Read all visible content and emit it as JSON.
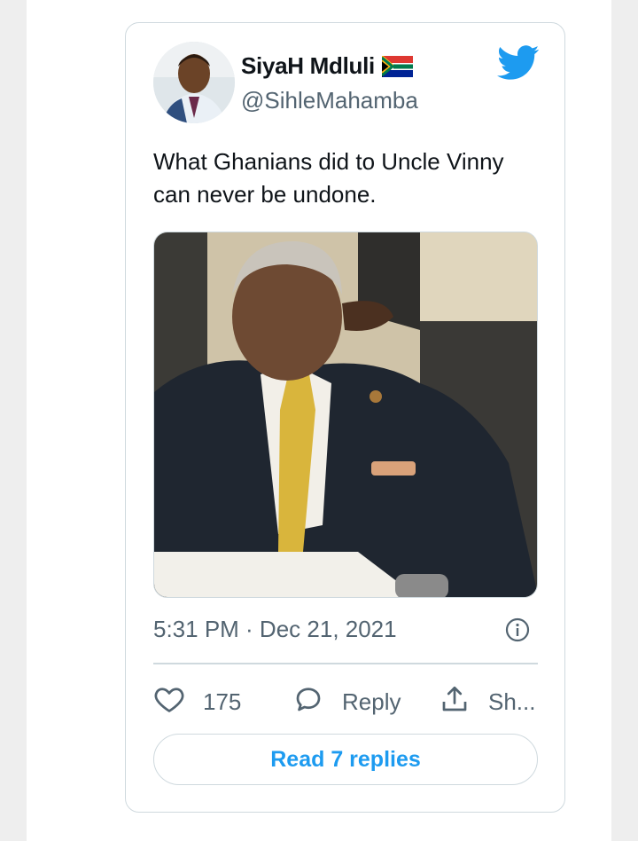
{
  "tweet": {
    "author_name": "SiyaH Mdluli",
    "author_handle": "@SihleMahamba",
    "flag_icon": "south-africa-flag-icon",
    "text": "What Ghanians did to Uncle Vinny can never be undone.",
    "timestamp": "5:31 PM · Dec 21, 2021",
    "like_count": "175",
    "reply_label": "Reply",
    "share_label": "Sh...",
    "read_replies_label": "Read 7 replies"
  },
  "colors": {
    "twitter_blue": "#1d9bf0",
    "text_primary": "#0f1419",
    "text_secondary": "#536471",
    "border": "#cfd9de"
  },
  "icons": [
    "twitter-bird-icon",
    "info-icon",
    "heart-icon",
    "reply-bubble-icon",
    "share-icon"
  ]
}
